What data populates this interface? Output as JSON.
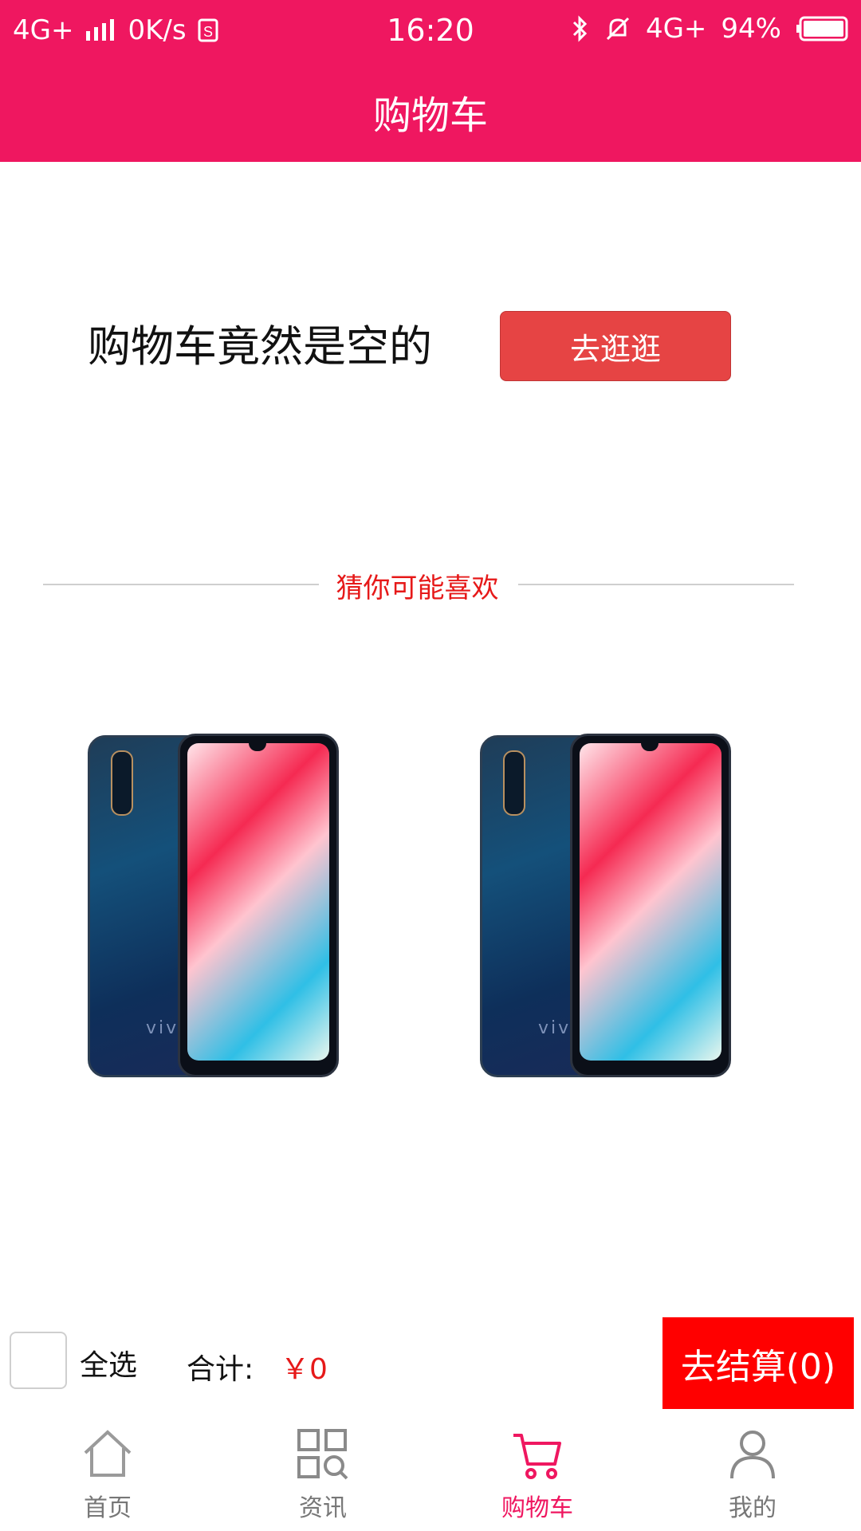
{
  "status_bar": {
    "network": "4G+",
    "speed": "0K/s",
    "time": "16:20",
    "network2": "4G+",
    "battery": "94%"
  },
  "header": {
    "title": "购物车"
  },
  "empty_cart": {
    "message": "购物车竟然是空的",
    "button_label": "去逛逛"
  },
  "recommend": {
    "heading": "猜你可能喜欢",
    "products": [
      {
        "brand": "vivo"
      },
      {
        "brand": "vivo"
      }
    ]
  },
  "footer_bar": {
    "select_all": "全选",
    "total_label": "合计:",
    "total_value": "￥0",
    "checkout_label": "去结算(0)"
  },
  "tabbar": {
    "tabs": [
      {
        "label": "首页",
        "icon": "home-icon"
      },
      {
        "label": "资讯",
        "icon": "grid-search-icon"
      },
      {
        "label": "购物车",
        "icon": "cart-icon",
        "active": true
      },
      {
        "label": "我的",
        "icon": "person-icon"
      }
    ]
  },
  "colors": {
    "brand": "#ef1760",
    "accent_red": "#e61919",
    "checkout_red": "#ff0000",
    "button_red": "#e64444"
  }
}
